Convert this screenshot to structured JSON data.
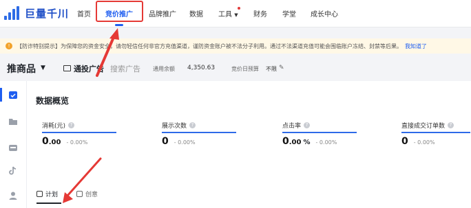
{
  "brand": {
    "name": "巨量千川"
  },
  "nav": {
    "items": [
      {
        "label": "首页"
      },
      {
        "label": "竞价推广"
      },
      {
        "label": "品牌推广"
      },
      {
        "label": "数据"
      },
      {
        "label": "工具"
      },
      {
        "label": "财务"
      },
      {
        "label": "学堂"
      },
      {
        "label": "成长中心"
      }
    ],
    "active": "竞价推广"
  },
  "notice": {
    "text": "【防诈特别提示】为保障您的资金安全，请勿轻信任何非官方充值渠道，谨防资金账户被不法分子利用。通过不法渠道充值可能会围临账户冻结、封禁等后果。",
    "link": "我知道了"
  },
  "subheader": {
    "product_title": "推商品",
    "mode_active": "通投广告",
    "mode_inactive": "搜索广告",
    "balance_label": "通用余额",
    "balance_value": "4,350.63",
    "budget_label": "竞价日预算",
    "budget_value": "不限"
  },
  "overview": {
    "title": "数据概览",
    "metrics": [
      {
        "label": "消耗(元)",
        "value_int": "0",
        "value_dec": ".00",
        "unit": "",
        "delta": "-  0.00%"
      },
      {
        "label": "展示次数",
        "value_int": "0",
        "value_dec": "",
        "unit": "",
        "delta": "-  0.00%"
      },
      {
        "label": "点击率",
        "value_int": "0",
        "value_dec": ".00",
        "unit": "%",
        "delta": "-  0.00%"
      },
      {
        "label": "直接成交订单数",
        "value_int": "0",
        "value_dec": "",
        "unit": "",
        "delta": "-  0.00%"
      }
    ]
  },
  "tabs": [
    {
      "label": "计划"
    },
    {
      "label": "创意"
    }
  ],
  "colors": {
    "accent": "#1f5ef0",
    "annotation": "#e53935",
    "notice_bg": "#fff8e6",
    "metric_line": "#2d6ae8"
  }
}
